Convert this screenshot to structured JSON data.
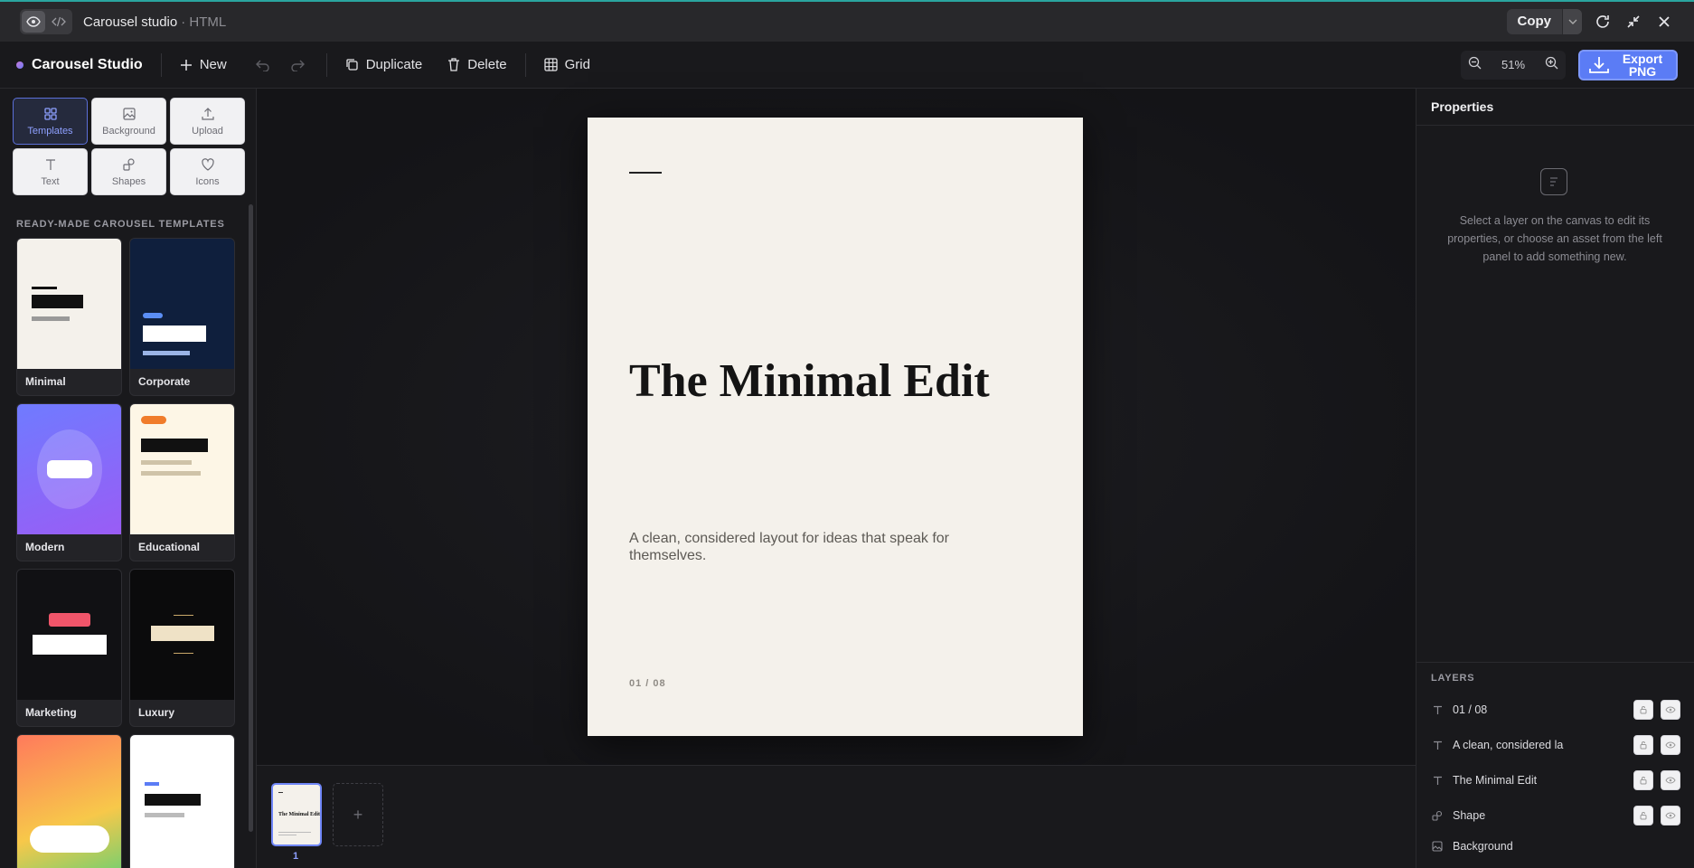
{
  "window": {
    "title": "Carousel studio",
    "subtitle": "· HTML",
    "copy_label": "Copy"
  },
  "app": {
    "brand": "Carousel Studio",
    "actions": {
      "new": "New",
      "duplicate": "Duplicate",
      "delete": "Delete",
      "grid": "Grid"
    },
    "zoom": "51%",
    "export": "Export PNG"
  },
  "tools": [
    {
      "label": "Templates",
      "icon": "grid-icon",
      "active": true
    },
    {
      "label": "Background",
      "icon": "image-icon"
    },
    {
      "label": "Upload",
      "icon": "upload-icon"
    },
    {
      "label": "Text",
      "icon": "text-icon"
    },
    {
      "label": "Shapes",
      "icon": "shapes-icon"
    },
    {
      "label": "Icons",
      "icon": "heart-icon"
    }
  ],
  "templates": {
    "heading": "READY-MADE CAROUSEL TEMPLATES",
    "items": [
      {
        "name": "Minimal"
      },
      {
        "name": "Corporate"
      },
      {
        "name": "Modern"
      },
      {
        "name": "Educational"
      },
      {
        "name": "Marketing"
      },
      {
        "name": "Luxury"
      }
    ]
  },
  "slide": {
    "headline": "The Minimal Edit",
    "body": "A clean, considered layout for ideas that speak for themselves.",
    "pager": "01 / 08"
  },
  "filmstrip": {
    "thumb_headline": "The Minimal Edit",
    "current": "1",
    "add": "+"
  },
  "properties": {
    "title": "Properties",
    "empty_message": "Select a layer on the canvas to edit its properties, or choose an asset from the left panel to add something new."
  },
  "layers": {
    "heading": "LAYERS",
    "items": [
      {
        "name": "01 / 08",
        "icon": "text-icon"
      },
      {
        "name": "A clean, considered la",
        "icon": "text-icon"
      },
      {
        "name": "The Minimal Edit",
        "icon": "text-icon"
      },
      {
        "name": "Shape",
        "icon": "shapes-icon"
      },
      {
        "name": "Background",
        "icon": "image-icon"
      }
    ]
  },
  "colors": {
    "accent": "#5b7cf5",
    "slide_bg": "#f4f1eb",
    "panel": "#19191c"
  }
}
